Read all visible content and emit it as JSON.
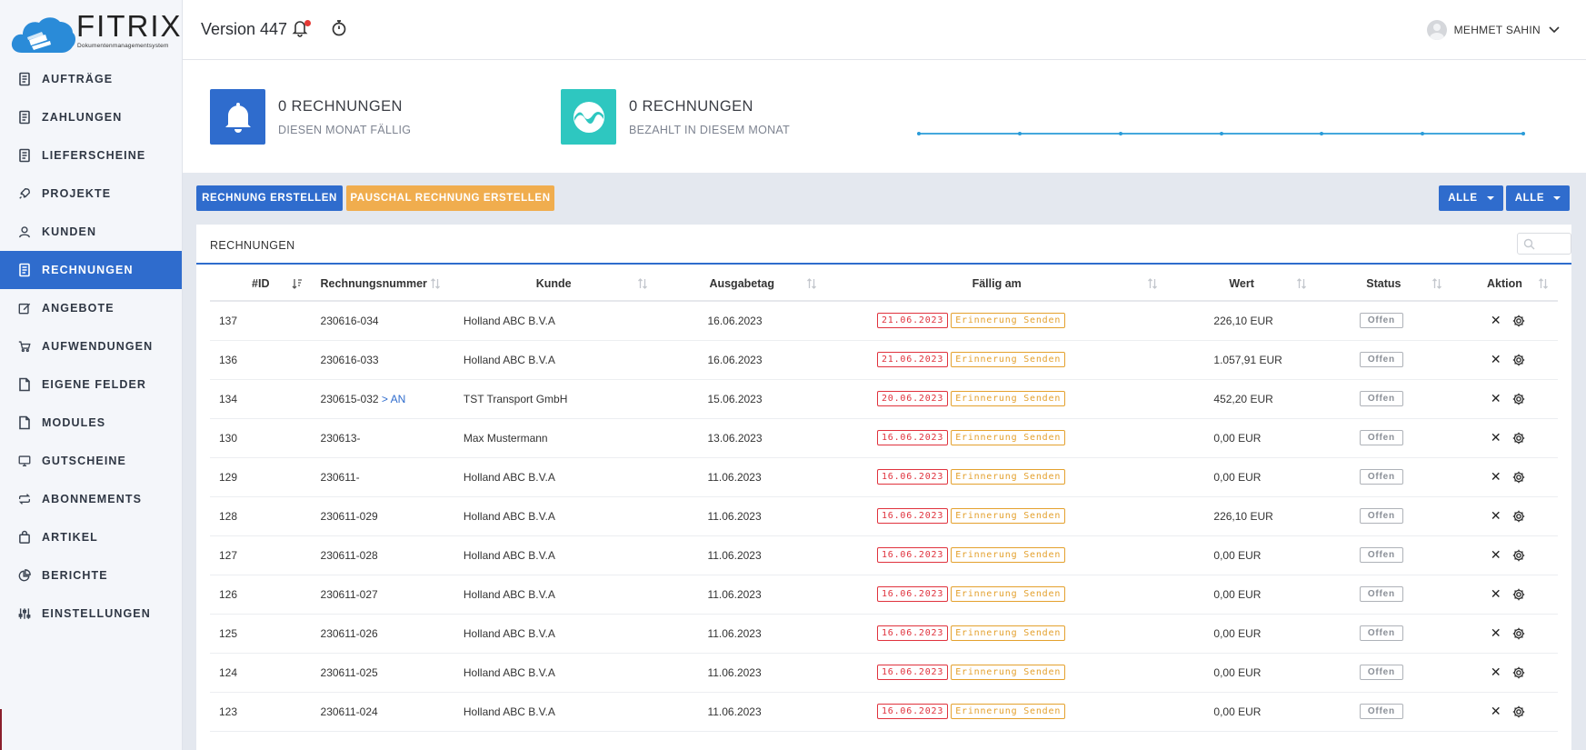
{
  "logo": {
    "name": "FITRIX",
    "subtitle": "Dokumentenmanagementsystem"
  },
  "header": {
    "version": "Version 447",
    "user": "MEHMET SAHIN"
  },
  "sidebar": {
    "items": [
      {
        "label": "AUFTRÄGE",
        "icon": "document-icon"
      },
      {
        "label": "ZAHLUNGEN",
        "icon": "document-icon"
      },
      {
        "label": "LIEFERSCHEINE",
        "icon": "document-icon"
      },
      {
        "label": "PROJEKTE",
        "icon": "rocket-icon"
      },
      {
        "label": "KUNDEN",
        "icon": "user-icon"
      },
      {
        "label": "RECHNUNGEN",
        "icon": "document-icon",
        "active": true
      },
      {
        "label": "ANGEBOTE",
        "icon": "edit-icon"
      },
      {
        "label": "AUFWENDUNGEN",
        "icon": "cart-icon"
      },
      {
        "label": "EIGENE FELDER",
        "icon": "file-icon"
      },
      {
        "label": "MODULES",
        "icon": "file-icon"
      },
      {
        "label": "GUTSCHEINE",
        "icon": "monitor-icon"
      },
      {
        "label": "ABONNEMENTS",
        "icon": "repeat-icon"
      },
      {
        "label": "ARTIKEL",
        "icon": "bag-icon"
      },
      {
        "label": "BERICHTE",
        "icon": "pie-icon"
      },
      {
        "label": "EINSTELLUNGEN",
        "icon": "sliders-icon"
      }
    ]
  },
  "stats": {
    "due": {
      "title": "0 RECHNUNGEN",
      "subtitle": "DIESEN MONAT FÄLLIG"
    },
    "paid": {
      "title": "0 RECHNUNGEN",
      "subtitle": "BEZAHLT IN DIESEM MONAT"
    }
  },
  "actions": {
    "create": "RECHNUNG ERSTELLEN",
    "create_flat": "PAUSCHAL RECHNUNG ERSTELLEN",
    "filter1": "ALLE",
    "filter2": "ALLE"
  },
  "table": {
    "title": "RECHNUNGEN",
    "columns": [
      "#ID",
      "Rechnungsnummer",
      "Kunde",
      "Ausgabetag",
      "Fällig am",
      "Wert",
      "Status",
      "Aktion"
    ],
    "reminder_label": "Erinnerung Senden",
    "rows": [
      {
        "id": "137",
        "number": "230616-034",
        "suffix": "",
        "customer": "Holland ABC B.V.A",
        "issued": "16.06.2023",
        "due": "21.06.2023",
        "value": "226,10 EUR",
        "status": "Offen"
      },
      {
        "id": "136",
        "number": "230616-033",
        "suffix": "",
        "customer": "Holland ABC B.V.A",
        "issued": "16.06.2023",
        "due": "21.06.2023",
        "value": "1.057,91 EUR",
        "status": "Offen"
      },
      {
        "id": "134",
        "number": "230615-032",
        "suffix": " > AN",
        "customer": "TST Transport GmbH",
        "issued": "15.06.2023",
        "due": "20.06.2023",
        "value": "452,20 EUR",
        "status": "Offen"
      },
      {
        "id": "130",
        "number": "230613-",
        "suffix": "",
        "customer": "Max Mustermann",
        "issued": "13.06.2023",
        "due": "16.06.2023",
        "value": "0,00 EUR",
        "status": "Offen"
      },
      {
        "id": "129",
        "number": "230611-",
        "suffix": "",
        "customer": "Holland ABC B.V.A",
        "issued": "11.06.2023",
        "due": "16.06.2023",
        "value": "0,00 EUR",
        "status": "Offen"
      },
      {
        "id": "128",
        "number": "230611-029",
        "suffix": "",
        "customer": "Holland ABC B.V.A",
        "issued": "11.06.2023",
        "due": "16.06.2023",
        "value": "226,10 EUR",
        "status": "Offen"
      },
      {
        "id": "127",
        "number": "230611-028",
        "suffix": "",
        "customer": "Holland ABC B.V.A",
        "issued": "11.06.2023",
        "due": "16.06.2023",
        "value": "0,00 EUR",
        "status": "Offen"
      },
      {
        "id": "126",
        "number": "230611-027",
        "suffix": "",
        "customer": "Holland ABC B.V.A",
        "issued": "11.06.2023",
        "due": "16.06.2023",
        "value": "0,00 EUR",
        "status": "Offen"
      },
      {
        "id": "125",
        "number": "230611-026",
        "suffix": "",
        "customer": "Holland ABC B.V.A",
        "issued": "11.06.2023",
        "due": "16.06.2023",
        "value": "0,00 EUR",
        "status": "Offen"
      },
      {
        "id": "124",
        "number": "230611-025",
        "suffix": "",
        "customer": "Holland ABC B.V.A",
        "issued": "11.06.2023",
        "due": "16.06.2023",
        "value": "0,00 EUR",
        "status": "Offen"
      },
      {
        "id": "123",
        "number": "230611-024",
        "suffix": "",
        "customer": "Holland ABC B.V.A",
        "issued": "11.06.2023",
        "due": "16.06.2023",
        "value": "0,00 EUR",
        "status": "Offen"
      }
    ]
  },
  "colors": {
    "primary": "#2f6ccd",
    "accent": "#f0ad4e",
    "teal": "#2ec7c0",
    "danger": "#e0323d"
  }
}
